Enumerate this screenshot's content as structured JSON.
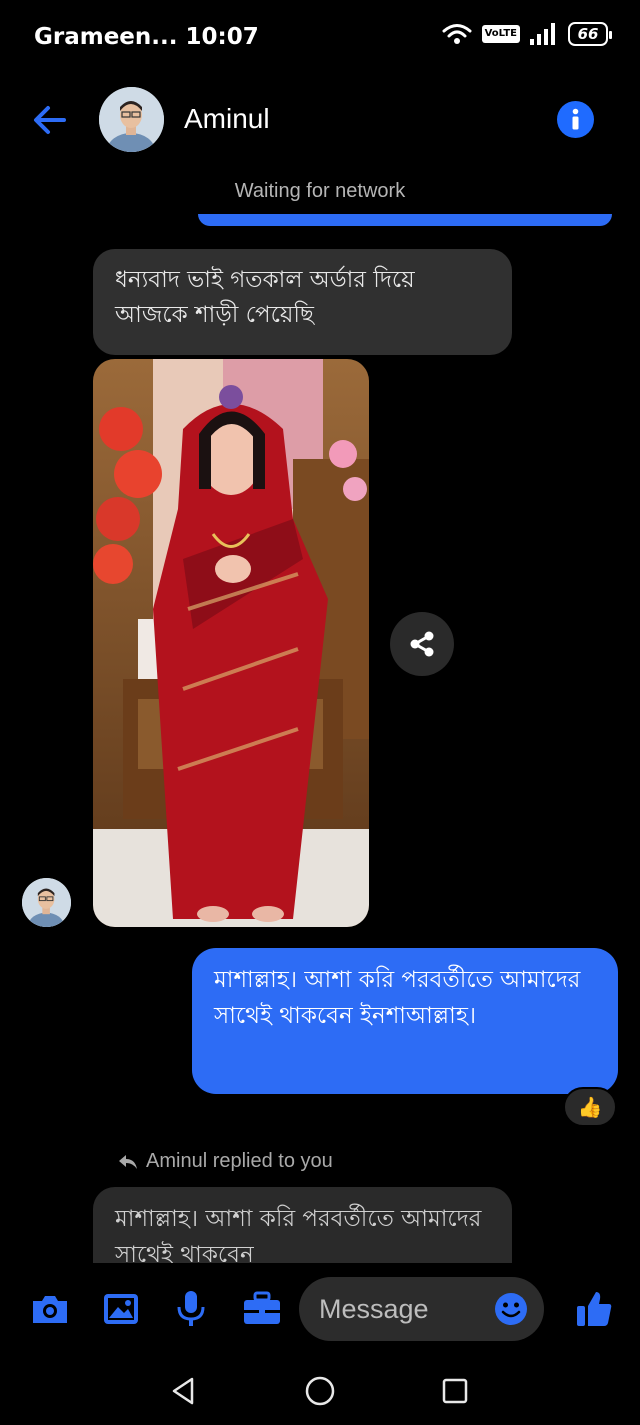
{
  "status_bar": {
    "carrier_time": "Grameen... 10:07",
    "volte": "VoLTE",
    "battery": "66"
  },
  "header": {
    "contact_name": "Aminul",
    "back_icon": "arrow-left-icon",
    "info_icon": "info-icon"
  },
  "network_status": "Waiting for network",
  "messages": [
    {
      "direction": "incoming",
      "text": "ধন্যবাদ ভাই গতকাল অর্ডার দিয়ে আজকে শাড়ী পেয়েছি"
    },
    {
      "direction": "incoming",
      "type": "photo"
    },
    {
      "direction": "outgoing",
      "text": "মাশাল্লাহ। আশা করি পরবর্তীতে আমাদের সাথেই থাকবেন ইনশাআল্লাহ।",
      "reaction": "👍"
    }
  ],
  "reply_label": "Aminul replied to you",
  "reply_text": "মাশাল্লাহ। আশা করি পরবর্তীতে আমাদের সাথেই থাকবেন",
  "composer": {
    "placeholder": "Message",
    "icons": [
      "camera-icon",
      "gallery-icon",
      "microphone-icon",
      "briefcase-icon",
      "emoji-icon",
      "thumbs-up-icon"
    ]
  },
  "colors": {
    "accent": "#2d6cf5",
    "incoming_bubble": "#303030",
    "background": "#000000"
  }
}
